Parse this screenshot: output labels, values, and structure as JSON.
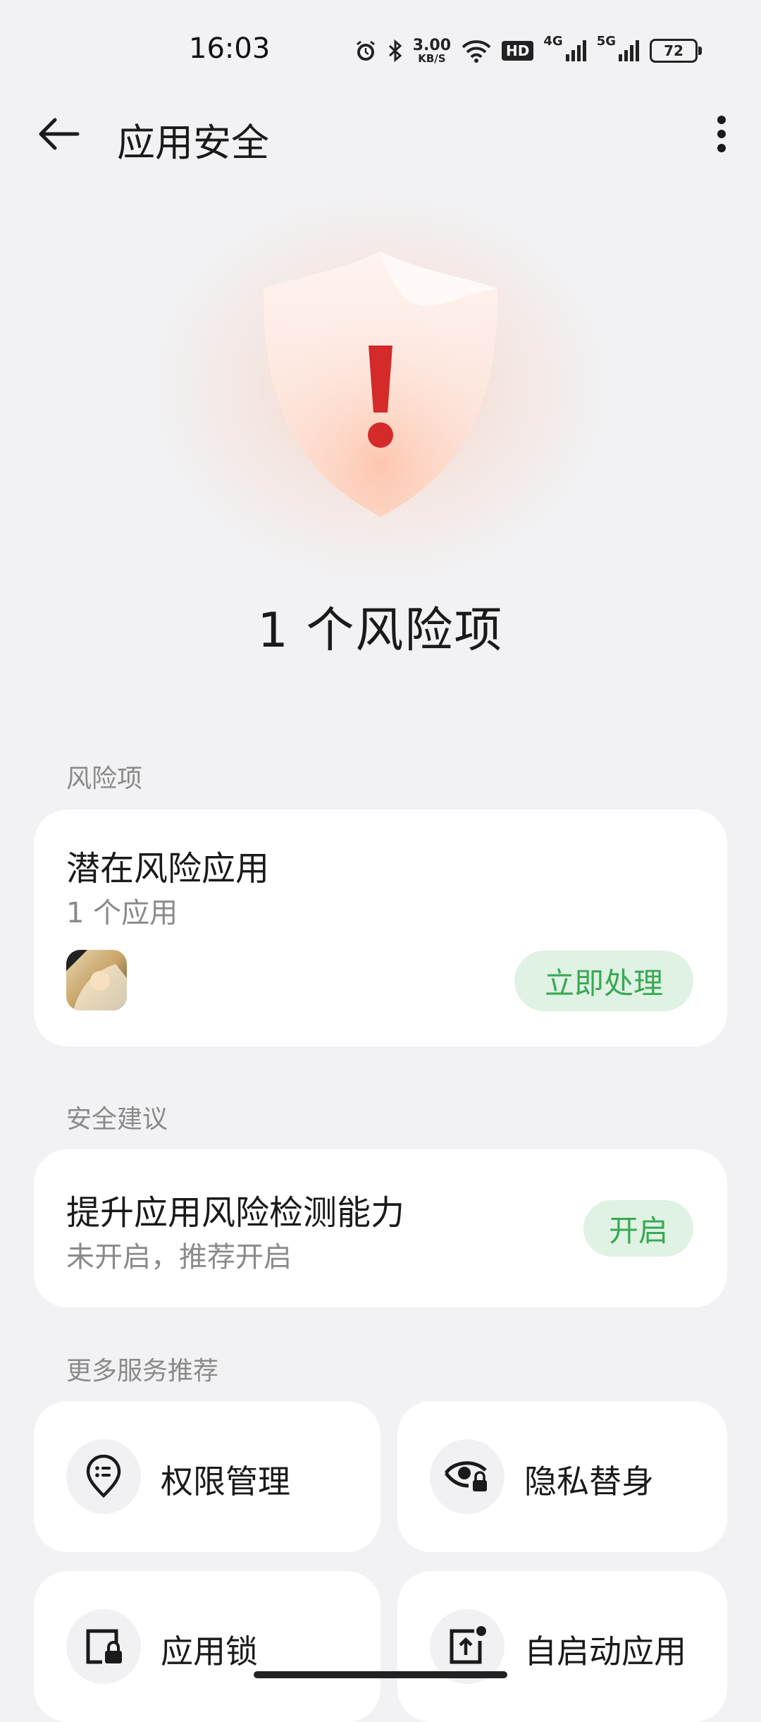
{
  "status_bar": {
    "time": "16:03",
    "net_speed_value": "3.00",
    "net_speed_unit": "KB/S",
    "hd_badge": "HD",
    "signal1_label": "4G",
    "signal2_label": "5G",
    "battery": "72",
    "icons": [
      "alarm-icon",
      "bluetooth-icon",
      "wifi-icon",
      "signal-icon",
      "battery-icon"
    ]
  },
  "header": {
    "title": "应用安全",
    "back_icon": "back-arrow-icon",
    "more_icon": "more-vertical-icon"
  },
  "hero": {
    "risk_count_text": "1 个风险项",
    "shield_icon": "shield-warning-icon"
  },
  "risk_section": {
    "label": "风险项",
    "card": {
      "title": "潜在风险应用",
      "subtitle": "1 个应用",
      "action_label": "立即处理"
    }
  },
  "suggestion_section": {
    "label": "安全建议",
    "card": {
      "title": "提升应用风险检测能力",
      "subtitle": "未开启，推荐开启",
      "action_label": "开启"
    }
  },
  "services_section": {
    "label": "更多服务推荐",
    "items": [
      {
        "label": "权限管理",
        "icon": "permission-location-icon"
      },
      {
        "label": "隐私替身",
        "icon": "privacy-eye-lock-icon"
      },
      {
        "label": "应用锁",
        "icon": "app-lock-icon"
      },
      {
        "label": "自启动应用",
        "icon": "autostart-icon"
      }
    ]
  },
  "colors": {
    "accent_green": "#3aa856",
    "pill_bg": "#dff2e3",
    "warning_red": "#d42a2a",
    "background": "#f2f2f4"
  }
}
